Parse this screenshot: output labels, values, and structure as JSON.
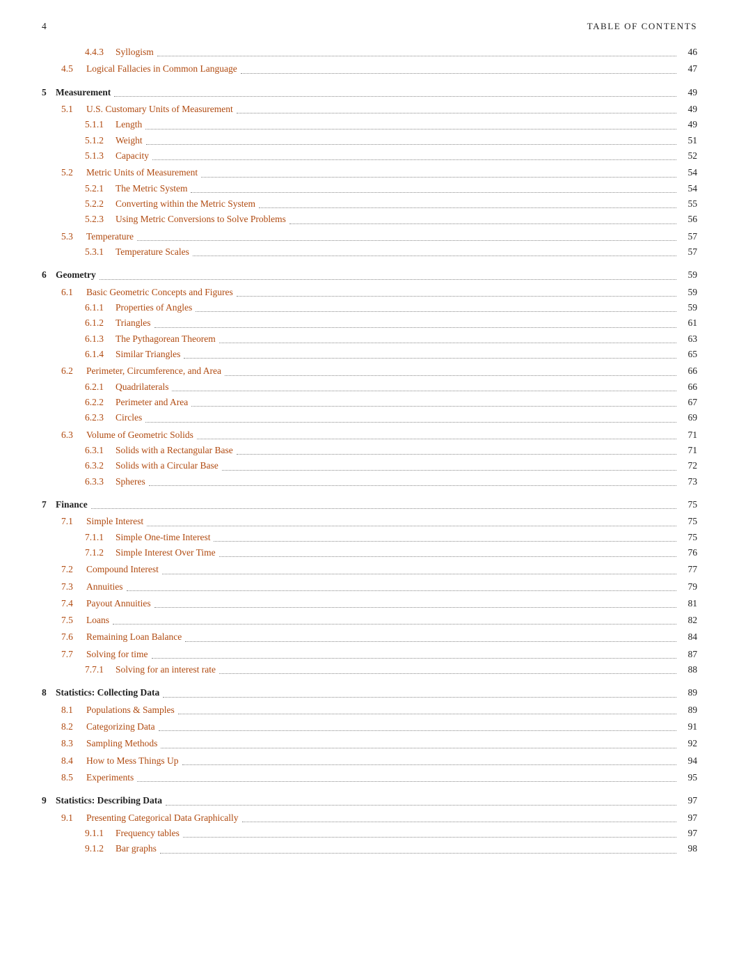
{
  "header": {
    "page_number": "4",
    "title": "TABLE OF CONTENTS"
  },
  "entries": [
    {
      "level": 2,
      "num": "4.4.3",
      "label": "Syllogism",
      "page": "46",
      "link": true
    },
    {
      "level": 1,
      "num": "4.5",
      "label": "Logical Fallacies in Common Language",
      "page": "47",
      "link": true
    },
    {
      "level": 0,
      "num": "5",
      "label": "Measurement",
      "page": "49",
      "link": false
    },
    {
      "level": 1,
      "num": "5.1",
      "label": "U.S. Customary Units of Measurement",
      "page": "49",
      "link": true
    },
    {
      "level": 2,
      "num": "5.1.1",
      "label": "Length",
      "page": "49",
      "link": true
    },
    {
      "level": 2,
      "num": "5.1.2",
      "label": "Weight",
      "page": "51",
      "link": true
    },
    {
      "level": 2,
      "num": "5.1.3",
      "label": "Capacity",
      "page": "52",
      "link": true
    },
    {
      "level": 1,
      "num": "5.2",
      "label": "Metric Units of Measurement",
      "page": "54",
      "link": true
    },
    {
      "level": 2,
      "num": "5.2.1",
      "label": "The Metric System",
      "page": "54",
      "link": true
    },
    {
      "level": 2,
      "num": "5.2.2",
      "label": "Converting within the Metric System",
      "page": "55",
      "link": true
    },
    {
      "level": 2,
      "num": "5.2.3",
      "label": "Using Metric Conversions to Solve Problems",
      "page": "56",
      "link": true
    },
    {
      "level": 1,
      "num": "5.3",
      "label": "Temperature",
      "page": "57",
      "link": true
    },
    {
      "level": 2,
      "num": "5.3.1",
      "label": "Temperature Scales",
      "page": "57",
      "link": true
    },
    {
      "level": 0,
      "num": "6",
      "label": "Geometry",
      "page": "59",
      "link": false
    },
    {
      "level": 1,
      "num": "6.1",
      "label": "Basic Geometric Concepts and Figures",
      "page": "59",
      "link": true
    },
    {
      "level": 2,
      "num": "6.1.1",
      "label": "Properties of Angles",
      "page": "59",
      "link": true
    },
    {
      "level": 2,
      "num": "6.1.2",
      "label": "Triangles",
      "page": "61",
      "link": true
    },
    {
      "level": 2,
      "num": "6.1.3",
      "label": "The Pythagorean Theorem",
      "page": "63",
      "link": true
    },
    {
      "level": 2,
      "num": "6.1.4",
      "label": "Similar Triangles",
      "page": "65",
      "link": true
    },
    {
      "level": 1,
      "num": "6.2",
      "label": "Perimeter, Circumference, and Area",
      "page": "66",
      "link": true
    },
    {
      "level": 2,
      "num": "6.2.1",
      "label": "Quadrilaterals",
      "page": "66",
      "link": true
    },
    {
      "level": 2,
      "num": "6.2.2",
      "label": "Perimeter and Area",
      "page": "67",
      "link": true
    },
    {
      "level": 2,
      "num": "6.2.3",
      "label": "Circles",
      "page": "69",
      "link": true
    },
    {
      "level": 1,
      "num": "6.3",
      "label": "Volume of Geometric Solids",
      "page": "71",
      "link": true
    },
    {
      "level": 2,
      "num": "6.3.1",
      "label": "Solids with a Rectangular Base",
      "page": "71",
      "link": true
    },
    {
      "level": 2,
      "num": "6.3.2",
      "label": "Solids with a Circular Base",
      "page": "72",
      "link": true
    },
    {
      "level": 2,
      "num": "6.3.3",
      "label": "Spheres",
      "page": "73",
      "link": true
    },
    {
      "level": 0,
      "num": "7",
      "label": "Finance",
      "page": "75",
      "link": false
    },
    {
      "level": 1,
      "num": "7.1",
      "label": "Simple Interest",
      "page": "75",
      "link": true
    },
    {
      "level": 2,
      "num": "7.1.1",
      "label": "Simple One-time Interest",
      "page": "75",
      "link": true
    },
    {
      "level": 2,
      "num": "7.1.2",
      "label": "Simple Interest Over Time",
      "page": "76",
      "link": true
    },
    {
      "level": 1,
      "num": "7.2",
      "label": "Compound Interest",
      "page": "77",
      "link": true
    },
    {
      "level": 1,
      "num": "7.3",
      "label": "Annuities",
      "page": "79",
      "link": true
    },
    {
      "level": 1,
      "num": "7.4",
      "label": "Payout Annuities",
      "page": "81",
      "link": true
    },
    {
      "level": 1,
      "num": "7.5",
      "label": "Loans",
      "page": "82",
      "link": true
    },
    {
      "level": 1,
      "num": "7.6",
      "label": "Remaining Loan Balance",
      "page": "84",
      "link": true
    },
    {
      "level": 1,
      "num": "7.7",
      "label": "Solving for time",
      "page": "87",
      "link": true
    },
    {
      "level": 2,
      "num": "7.7.1",
      "label": "Solving for an interest rate",
      "page": "88",
      "link": true
    },
    {
      "level": 0,
      "num": "8",
      "label": "Statistics: Collecting Data",
      "page": "89",
      "link": false
    },
    {
      "level": 1,
      "num": "8.1",
      "label": "Populations & Samples",
      "page": "89",
      "link": true
    },
    {
      "level": 1,
      "num": "8.2",
      "label": "Categorizing Data",
      "page": "91",
      "link": true
    },
    {
      "level": 1,
      "num": "8.3",
      "label": "Sampling Methods",
      "page": "92",
      "link": true
    },
    {
      "level": 1,
      "num": "8.4",
      "label": "How to Mess Things Up",
      "page": "94",
      "link": true
    },
    {
      "level": 1,
      "num": "8.5",
      "label": "Experiments",
      "page": "95",
      "link": true
    },
    {
      "level": 0,
      "num": "9",
      "label": "Statistics: Describing Data",
      "page": "97",
      "link": false
    },
    {
      "level": 1,
      "num": "9.1",
      "label": "Presenting Categorical Data Graphically",
      "page": "97",
      "link": true
    },
    {
      "level": 2,
      "num": "9.1.1",
      "label": "Frequency tables",
      "page": "97",
      "link": true
    },
    {
      "level": 2,
      "num": "9.1.2",
      "label": "Bar graphs",
      "page": "98",
      "link": true
    }
  ]
}
